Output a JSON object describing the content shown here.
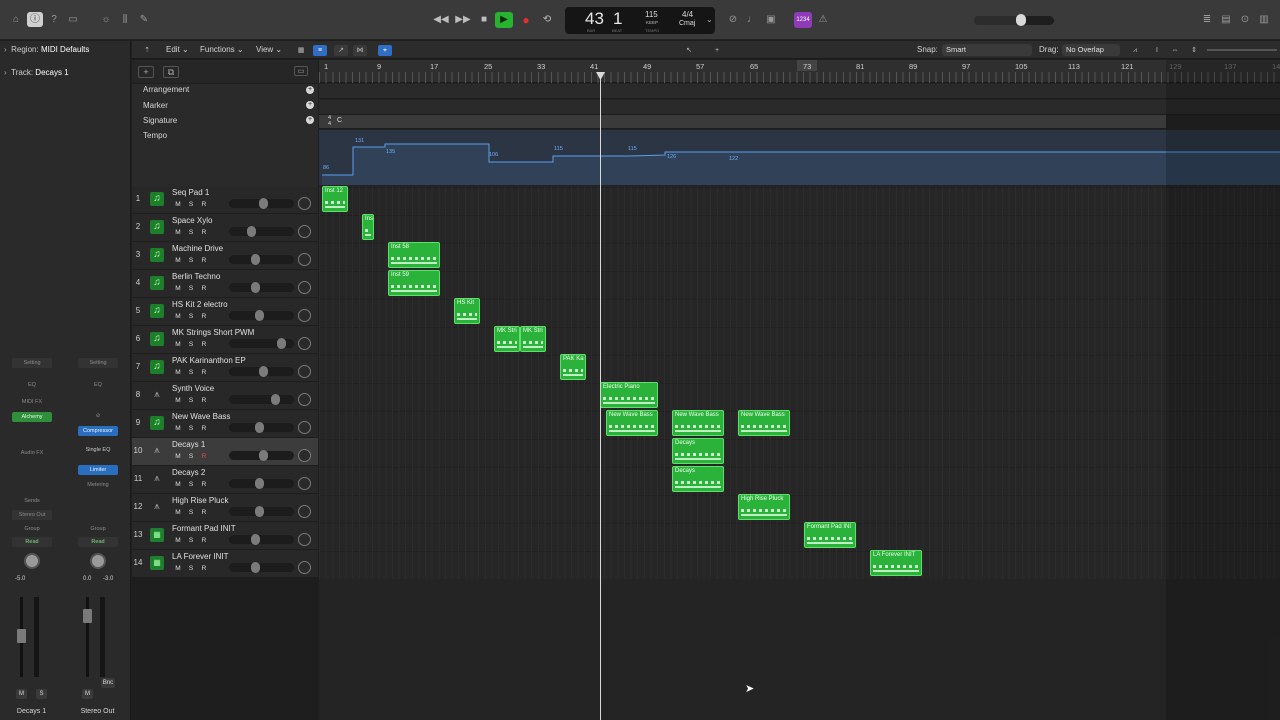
{
  "transport": {
    "bar": "43",
    "beat": "1",
    "bar_label": "BAR",
    "beat_label": "BEAT",
    "tempo": "115",
    "tempo_mode": "KEEP",
    "tempo_label": "TEMPO",
    "time_signature": "4/4",
    "key": "Cmaj",
    "count_in": "1234"
  },
  "colors": {
    "accent": "#27b330",
    "region": "#2bb23a",
    "selection": "#2f6ec2",
    "record": "#e0312a",
    "count_in_badge": "#8f3ab8"
  },
  "inspector": {
    "region_label": "Region:",
    "region_value": "MIDI Defaults",
    "track_label": "Track:",
    "track_value": "Decays 1",
    "strip1": {
      "setting": "Setting",
      "eq": "EQ",
      "midi_fx": "MIDI FX",
      "instrument": "Alchemy",
      "audio_fx": "Audio FX",
      "sends": "Sends",
      "output": "Stereo Out",
      "group": "Group",
      "automation": "Read",
      "pan_value": "-5.0",
      "mute": "M",
      "solo": "S",
      "name": "Decays 1"
    },
    "strip2": {
      "setting": "Setting",
      "eq": "EQ",
      "fx1": "Compressor",
      "fx2": "Single EQ",
      "fx3": "Limiter",
      "fx4": "Metering",
      "group": "Group",
      "automation": "Read",
      "val1": "0.0",
      "val2": "-3.0",
      "mute": "M",
      "bounce": "Bnc",
      "name": "Stereo Out"
    }
  },
  "editbar": {
    "edit": "Edit",
    "functions": "Functions",
    "view": "View",
    "snap_label": "Snap:",
    "snap_value": "Smart",
    "drag_label": "Drag:",
    "drag_value": "No Overlap"
  },
  "global_tracks": {
    "arrangement": "Arrangement",
    "marker": "Marker",
    "signature": "Signature",
    "tempo": "Tempo",
    "signature_value": "C",
    "tempo_scale": [
      "160",
      "140",
      "120",
      "100",
      "80",
      "70"
    ],
    "tempo_points": [
      "86",
      "131",
      "135",
      "106",
      "115",
      "115",
      "126",
      "122"
    ]
  },
  "ruler": [
    "1",
    "9",
    "17",
    "25",
    "33",
    "41",
    "49",
    "57",
    "65",
    "73",
    "81",
    "89",
    "97",
    "105",
    "113",
    "121",
    "129",
    "137",
    "14"
  ],
  "tracks": [
    {
      "num": "1",
      "name": "Seq Pad 1",
      "icon": "instrument-icon"
    },
    {
      "num": "2",
      "name": "Space Xylo",
      "icon": "instrument-icon"
    },
    {
      "num": "3",
      "name": "Machine Drive",
      "icon": "instrument-icon"
    },
    {
      "num": "4",
      "name": "Berlin Techno",
      "icon": "instrument-icon"
    },
    {
      "num": "5",
      "name": "HS Kit 2 electro",
      "icon": "instrument-icon"
    },
    {
      "num": "6",
      "name": "MK Strings Short PWM",
      "icon": "instrument-icon"
    },
    {
      "num": "7",
      "name": "PAK Karinanthon EP",
      "icon": "instrument-icon"
    },
    {
      "num": "8",
      "name": "Synth Voice",
      "icon": "synth-icon"
    },
    {
      "num": "9",
      "name": "New Wave Bass",
      "icon": "instrument-icon"
    },
    {
      "num": "10",
      "name": "Decays 1",
      "icon": "synth-icon"
    },
    {
      "num": "11",
      "name": "Decays 2",
      "icon": "synth-icon"
    },
    {
      "num": "12",
      "name": "High Rise Pluck",
      "icon": "synth-icon"
    },
    {
      "num": "13",
      "name": "Formant Pad INIT",
      "icon": "pad-icon"
    },
    {
      "num": "14",
      "name": "LA Forever INIT",
      "icon": "pad-icon"
    }
  ],
  "track_buttons": {
    "mute": "M",
    "solo": "S",
    "record": "R"
  },
  "regions": [
    {
      "name": "Inst 12"
    },
    {
      "name": "Ins"
    },
    {
      "name": "Inst 58"
    },
    {
      "name": "Inst 59"
    },
    {
      "name": "HS Kit"
    },
    {
      "name": "MK Stri"
    },
    {
      "name": "MK Stri"
    },
    {
      "name": "PAK Ka"
    },
    {
      "name": "Electric Piano"
    },
    {
      "name": "New Wave Bass"
    },
    {
      "name": "New Wave Bass"
    },
    {
      "name": "New Wave Bass"
    },
    {
      "name": "Decays"
    },
    {
      "name": "Decays"
    },
    {
      "name": "High Rise Pluck"
    },
    {
      "name": "Formant Pad INI"
    },
    {
      "name": "LA Forever INIT"
    }
  ]
}
